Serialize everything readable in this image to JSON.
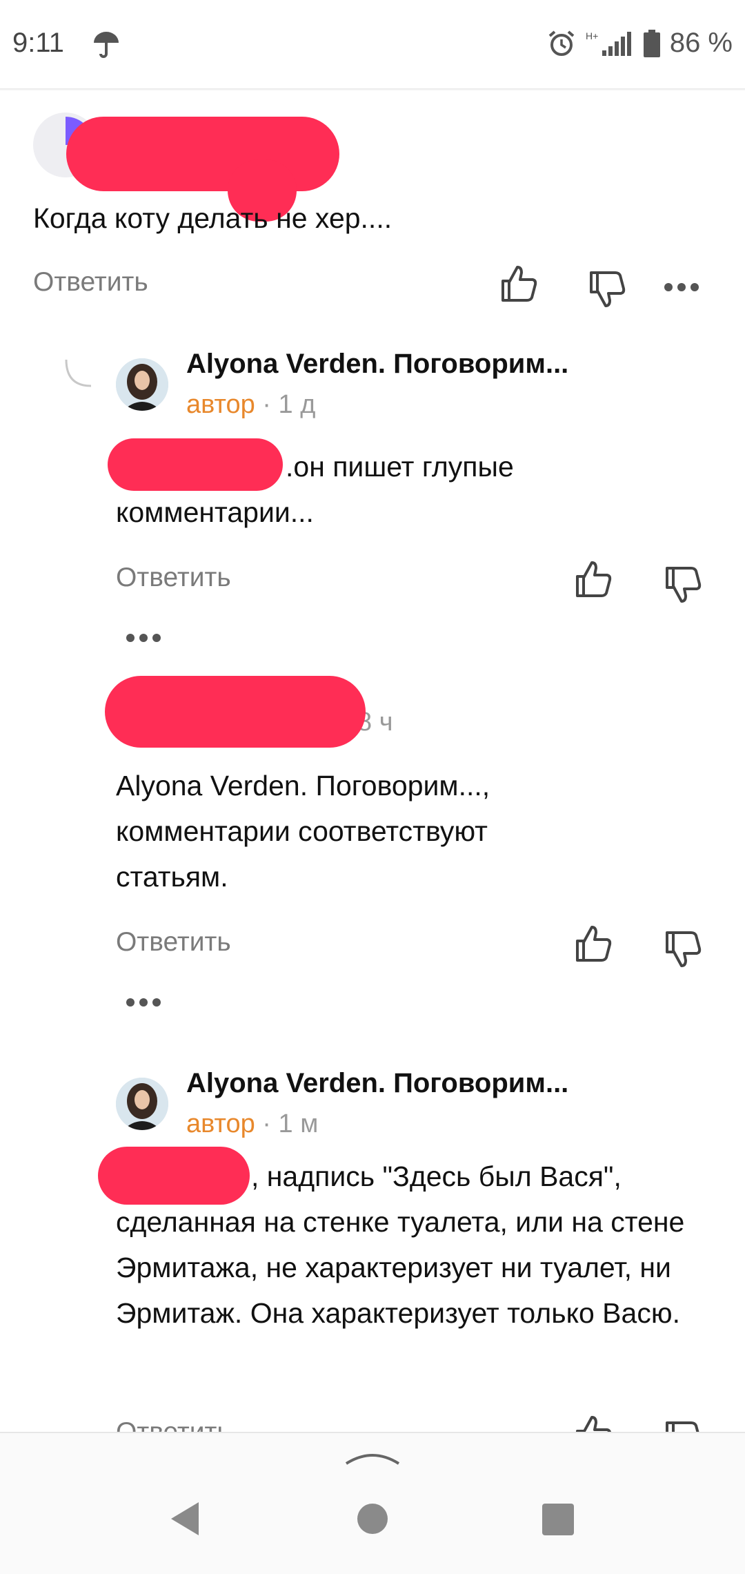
{
  "status": {
    "time": "9:11",
    "network": "H+",
    "battery": "86 %"
  },
  "comments": [
    {
      "text": "Когда коту делать не хер....",
      "reply": "Ответить"
    },
    {
      "author": "Alyona Verden. Поговорим...",
      "tag": "автор",
      "time": "· 1 д",
      "text_line1": ".он пишет глупые",
      "text_line2": "комментарии...",
      "reply": "Ответить"
    },
    {
      "time": "8 ч",
      "text": "Alyona Verden. Поговорим..., комментарии соответствуют статьям.",
      "reply": "Ответить"
    },
    {
      "author": "Alyona Verden. Поговорим...",
      "tag": "автор",
      "time": "· 1 м",
      "text_line1": ", надпись \"Здесь был Вася\",",
      "text_rest": "сделанная на стенке туалета, или на стене Эрмитажа, не характеризует ни туалет, ни Эрмитаж. Она характеризует только Васю.",
      "reply": "Ответить"
    }
  ],
  "colors": {
    "censor": "#ff2d55",
    "author_tag": "#e8882c",
    "muted": "#7a7a7a"
  }
}
